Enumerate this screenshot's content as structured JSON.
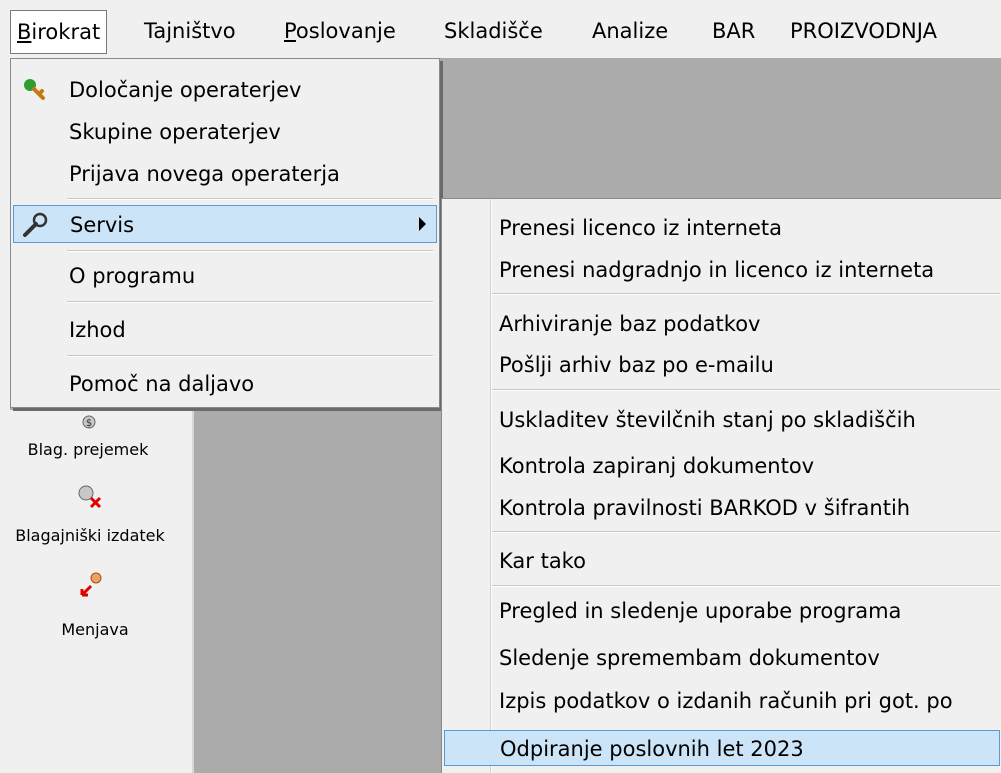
{
  "menubar": {
    "items": [
      {
        "label": "Birokrat",
        "mnemonic": "B",
        "rest": "irokrat"
      },
      {
        "label": "Tajništvo",
        "mnemonic": "",
        "rest": "Tajništvo"
      },
      {
        "label": "Poslovanje",
        "mnemonic": "P",
        "rest": "oslovanje"
      },
      {
        "label": "Skladišče"
      },
      {
        "label": "Analize"
      },
      {
        "label": "BAR"
      },
      {
        "label": "PROIZVODNJA"
      }
    ]
  },
  "birokrat_menu": {
    "items": [
      {
        "label": "Določanje operaterjev",
        "icon": "key-icon"
      },
      {
        "label": "Skupine operaterjev"
      },
      {
        "label": "Prijava novega operaterja"
      },
      {
        "label": "Servis",
        "icon": "wrench-icon",
        "has_submenu": true,
        "selected": true
      },
      {
        "label": "O programu"
      },
      {
        "label": "Izhod"
      },
      {
        "label": "Pomoč na daljavo"
      }
    ]
  },
  "servis_submenu": {
    "items": [
      {
        "label": "Prenesi licenco iz interneta"
      },
      {
        "label": "Prenesi nadgradnjo in licenco iz interneta"
      },
      {
        "label": "Arhiviranje baz podatkov"
      },
      {
        "label": "Pošlji arhiv baz po e-mailu"
      },
      {
        "label": "Uskladitev številčnih stanj po skladiščih"
      },
      {
        "label": "Kontrola zapiranj dokumentov"
      },
      {
        "label": "Kontrola pravilnosti BARKOD v šifrantih"
      },
      {
        "label": "Kar tako"
      },
      {
        "label": "Pregled in sledenje uporabe programa"
      },
      {
        "label": "Sledenje spremembam dokumentov"
      },
      {
        "label": "Izpis podatkov o izdanih računih pri got. po"
      },
      {
        "label": "Odpiranje poslovnih let 2023",
        "selected": true
      }
    ]
  },
  "toolbar": {
    "items": [
      {
        "label": "Blag. prejemek",
        "icon": "cash-receipt-icon"
      },
      {
        "label": "Blagajniški izdatek",
        "icon": "cash-expense-icon"
      },
      {
        "label": "Menjava",
        "icon": "exchange-icon"
      }
    ]
  },
  "colors": {
    "menu_bg": "#f0f0f0",
    "workspace_bg": "#ababab",
    "selection_bg": "#cce4f7",
    "selection_border": "#5b9bd5"
  }
}
